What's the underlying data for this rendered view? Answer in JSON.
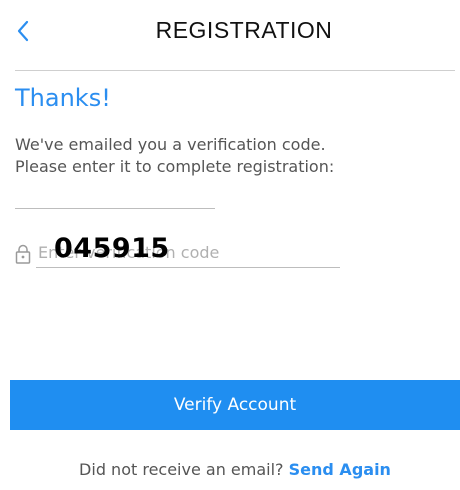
{
  "header": {
    "title": "REGISTRATION",
    "back_icon": "chevron-left-icon"
  },
  "content": {
    "heading": "Thanks!",
    "message_line1": "We've emailed you a verification code.",
    "message_line2": "Please enter it to complete registration:"
  },
  "code_field": {
    "icon": "lock-icon",
    "placeholder": "Enter verification code",
    "value": "045915"
  },
  "actions": {
    "verify_label": "Verify Account",
    "resend_prompt": "Did not receive an email?",
    "resend_link": "Send Again"
  },
  "colors": {
    "accent": "#2b8ef0",
    "button_bg": "#1f8ef1"
  }
}
